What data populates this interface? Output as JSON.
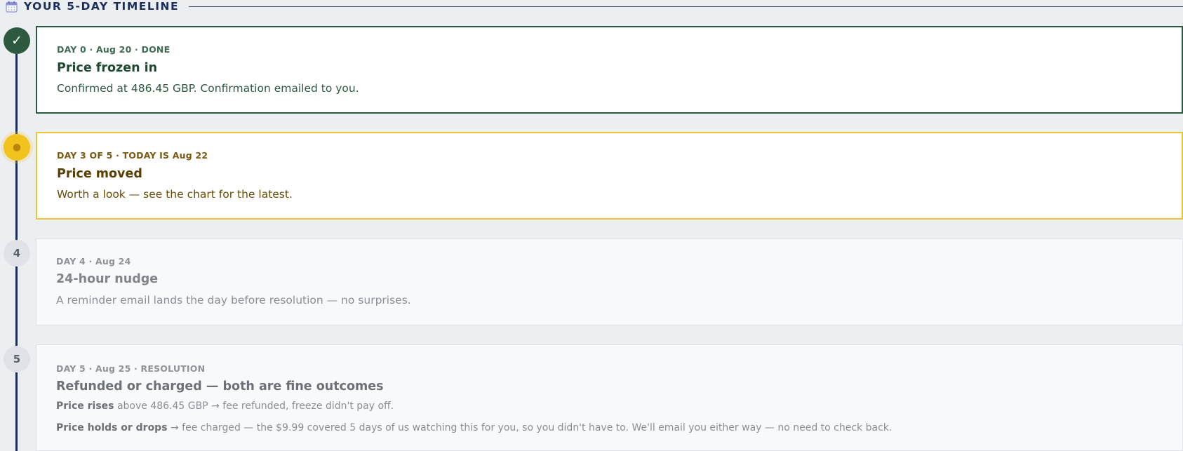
{
  "header": {
    "title": "YOUR 5-DAY TIMELINE",
    "icon": "calendar-icon"
  },
  "colors": {
    "done": "#2d5a3f",
    "current": "#f2c31c",
    "navy": "#1b2f5a",
    "future": "#dfe3e7"
  },
  "timeline": {
    "done": {
      "marker": "✓",
      "eyebrow": "DAY 0 · Aug 20 · DONE",
      "title": "Price frozen in",
      "body": "Confirmed at 486.45 GBP. Confirmation emailed to you."
    },
    "current": {
      "marker": "●",
      "eyebrow": "DAY 3 OF 5 · TODAY IS Aug 22",
      "title": "Price moved",
      "body": "Worth a look — see the chart for the latest."
    },
    "day4": {
      "marker": "4",
      "eyebrow": "DAY 4 · Aug 24",
      "title": "24-hour nudge",
      "body": "A reminder email lands the day before resolution — no surprises."
    },
    "day5": {
      "marker": "5",
      "eyebrow": "DAY 5 · Aug 25 · RESOLUTION",
      "title": "Refunded or charged — both are fine outcomes",
      "line1_bold": "Price rises",
      "line1_text": " above 486.45 GBP → fee refunded, freeze didn't pay off.",
      "line2_bold": "Price holds or drops",
      "line2_text": " → fee charged — the $9.99 covered 5 days of us watching this for you, so you didn't have to. We'll email you either way — no need to check back."
    }
  }
}
